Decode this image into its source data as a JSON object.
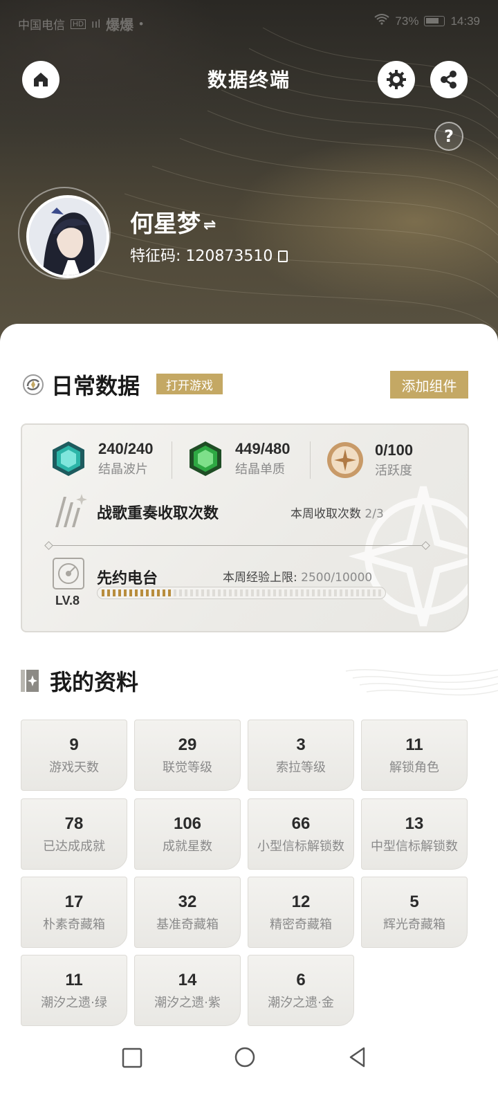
{
  "status_bar": {
    "carrier": "中国电信",
    "carrier_badge": "HD",
    "signal": "ııl",
    "apps": "爆爆",
    "dot": "•",
    "battery": "73%",
    "time": "14:39"
  },
  "header": {
    "title": "数据终端",
    "home_icon": "home-icon",
    "settings_icon": "gear-icon",
    "share_icon": "share-icon",
    "help_label": "?"
  },
  "profile": {
    "name": "何星梦",
    "switch_glyph": "⇌",
    "uid_label": "特征码: 120873510"
  },
  "daily": {
    "title": "日常数据",
    "open_game": "打开游戏",
    "add_widget": "添加组件",
    "stats": [
      {
        "value": "240/240",
        "label": "结晶波片",
        "icon": "cyan-crystal-icon"
      },
      {
        "value": "449/480",
        "label": "结晶单质",
        "icon": "green-crystal-icon"
      },
      {
        "value": "0/100",
        "label": "活跃度",
        "icon": "compass-medal-icon"
      }
    ],
    "battle_song": {
      "title": "战歌重奏收取次数",
      "note_label": "本周收取次数",
      "note_value": "2/3"
    },
    "radio": {
      "title": "先约电台",
      "note_label": "本周经验上限:",
      "note_value": "2500/10000",
      "level": "LV.8",
      "progress": 0.25
    }
  },
  "my_profile": {
    "title": "我的资料",
    "items": [
      {
        "value": "9",
        "label": "游戏天数"
      },
      {
        "value": "29",
        "label": "联觉等级"
      },
      {
        "value": "3",
        "label": "索拉等级"
      },
      {
        "value": "11",
        "label": "解锁角色"
      },
      {
        "value": "78",
        "label": "已达成成就"
      },
      {
        "value": "106",
        "label": "成就星数"
      },
      {
        "value": "66",
        "label": "小型信标解锁数"
      },
      {
        "value": "13",
        "label": "中型信标解锁数"
      },
      {
        "value": "17",
        "label": "朴素奇藏箱"
      },
      {
        "value": "32",
        "label": "基准奇藏箱"
      },
      {
        "value": "12",
        "label": "精密奇藏箱"
      },
      {
        "value": "5",
        "label": "辉光奇藏箱"
      },
      {
        "value": "11",
        "label": "潮汐之遗·绿"
      },
      {
        "value": "14",
        "label": "潮汐之遗·紫"
      },
      {
        "value": "6",
        "label": "潮汐之遗·金"
      }
    ]
  },
  "colors": {
    "accent_gold": "#c4a864",
    "progress_fill": "#b88d3d",
    "card_bg": "#eeede9"
  }
}
